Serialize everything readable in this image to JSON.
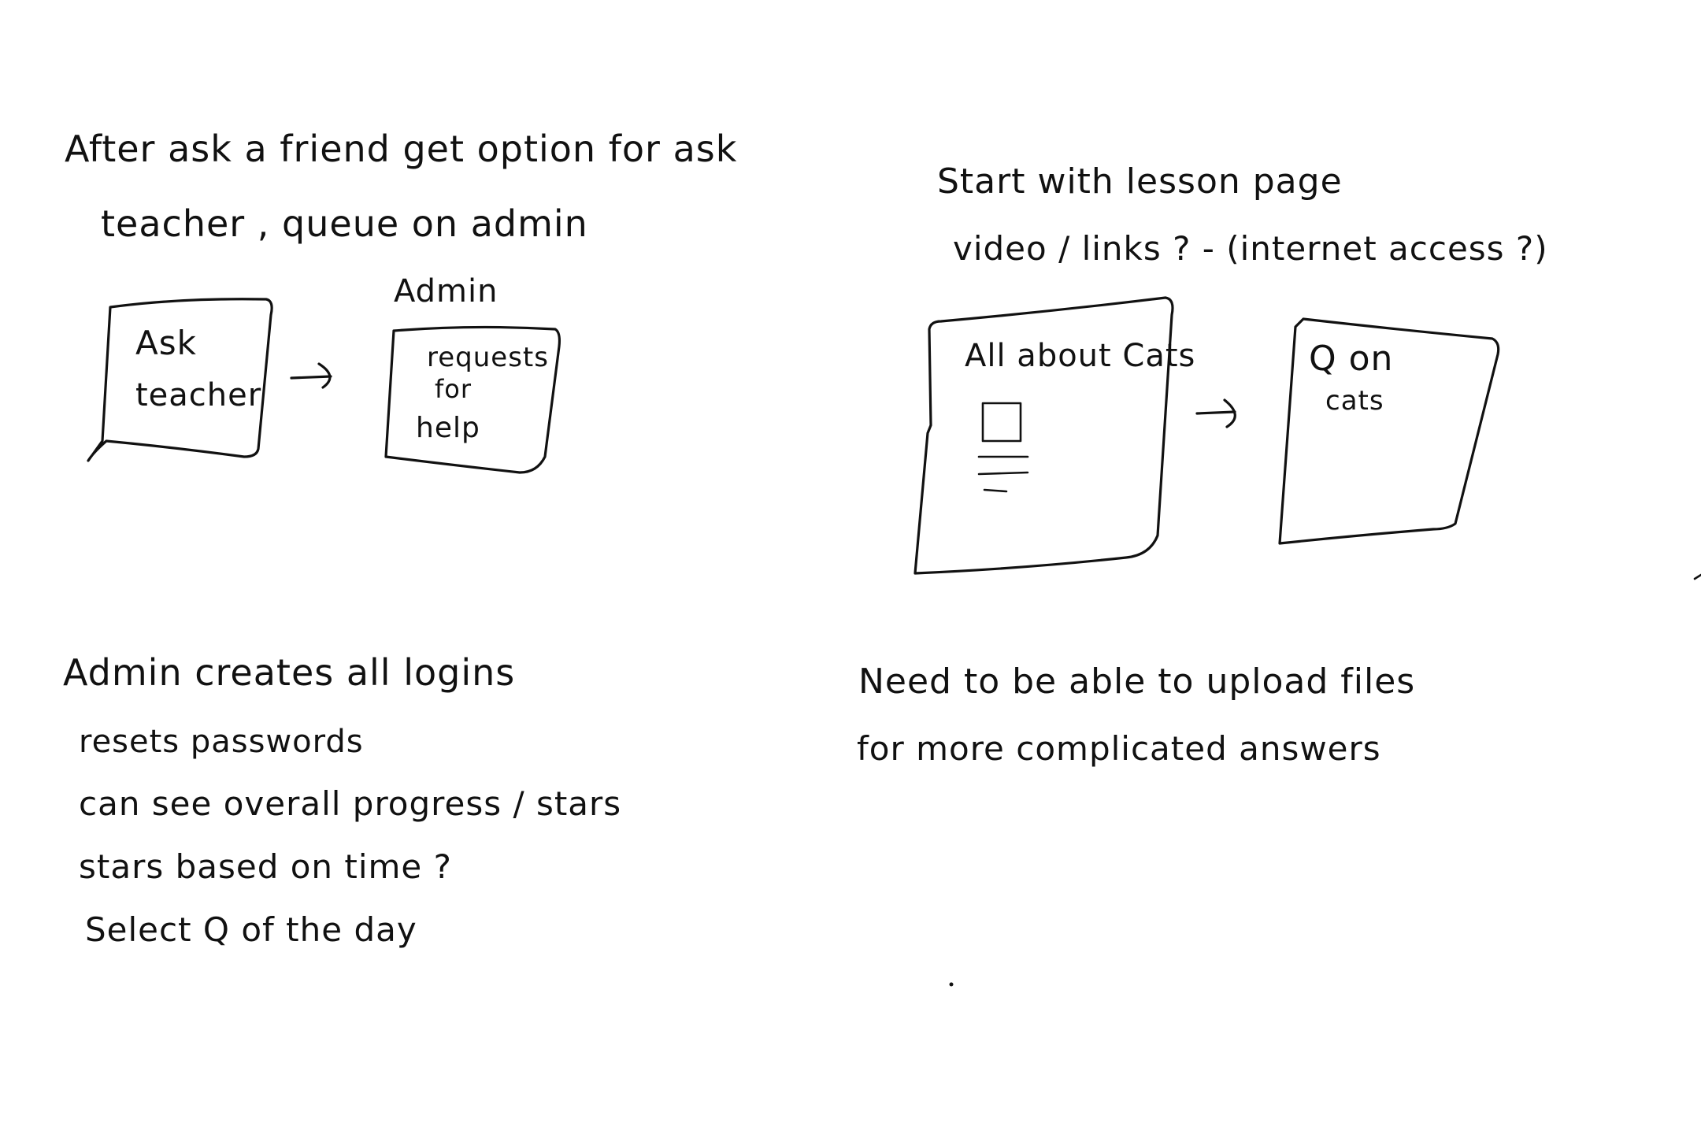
{
  "notes": {
    "friend_note": {
      "line1": "After ask a friend get option for ask",
      "line2": "teacher , queue on admin"
    },
    "admin_label": "Admin",
    "ask_teacher_box": {
      "line1": "Ask",
      "line2": "teacher"
    },
    "admin_box": {
      "line1": "requests",
      "line2": "for",
      "line3": "help"
    },
    "lesson_note": {
      "line1": "Start with lesson page",
      "line2": "video / links ? - (internet access ?)"
    },
    "lesson_box": {
      "title": "All about Cats"
    },
    "q_box": {
      "line1": "Q on",
      "line2": "cats"
    },
    "admin_list": [
      "Admin creates all logins",
      "resets passwords",
      "can see overall progress / stars",
      "stars based on time ?",
      "Select Q of the day"
    ],
    "upload_note": {
      "line1": "Need to be able to upload files",
      "line2": "for more complicated answers"
    },
    "arrow_glyph": "→"
  }
}
